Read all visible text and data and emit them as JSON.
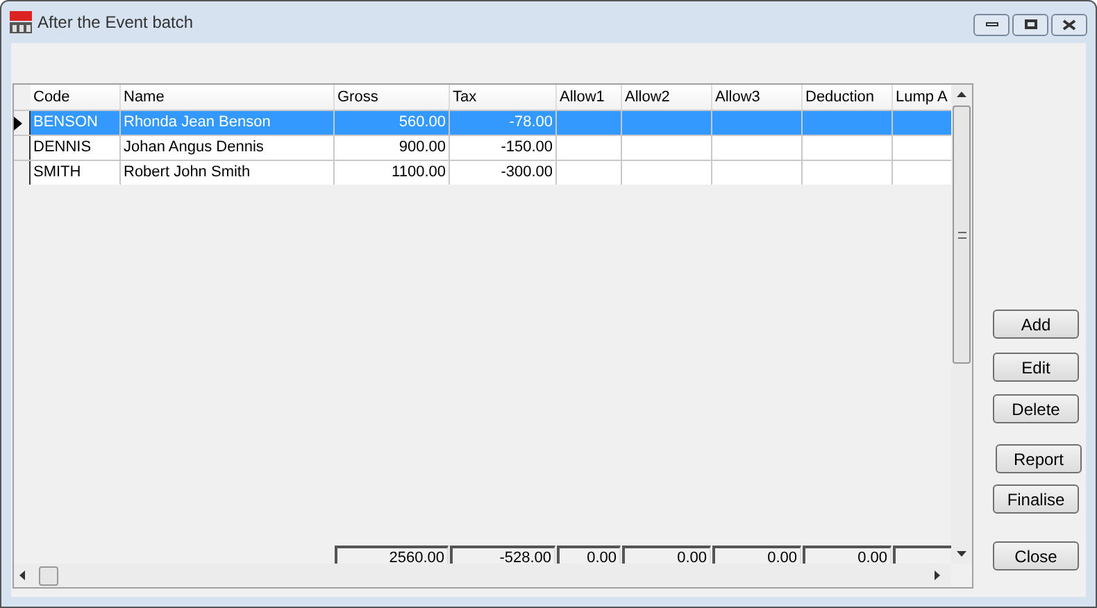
{
  "window": {
    "title": "After the Event batch"
  },
  "table": {
    "columns": [
      "Code",
      "Name",
      "Gross",
      "Tax",
      "Allow1",
      "Allow2",
      "Allow3",
      "Deduction",
      "Lump A"
    ],
    "rows": [
      {
        "selected": true,
        "cells": [
          "BENSON",
          "Rhonda Jean Benson",
          "560.00",
          "-78.00",
          "",
          "",
          "",
          "",
          ""
        ]
      },
      {
        "selected": false,
        "cells": [
          "DENNIS",
          "Johan Angus Dennis",
          "900.00",
          "-150.00",
          "",
          "",
          "",
          "",
          ""
        ]
      },
      {
        "selected": false,
        "cells": [
          "SMITH",
          "Robert John Smith",
          "1100.00",
          "-300.00",
          "",
          "",
          "",
          "",
          ""
        ]
      }
    ],
    "totals": [
      "2560.00",
      "-528.00",
      "0.00",
      "0.00",
      "0.00",
      "0.00"
    ]
  },
  "buttons": [
    "Add",
    "Edit",
    "Delete",
    "Report",
    "Finalise",
    "Close"
  ]
}
